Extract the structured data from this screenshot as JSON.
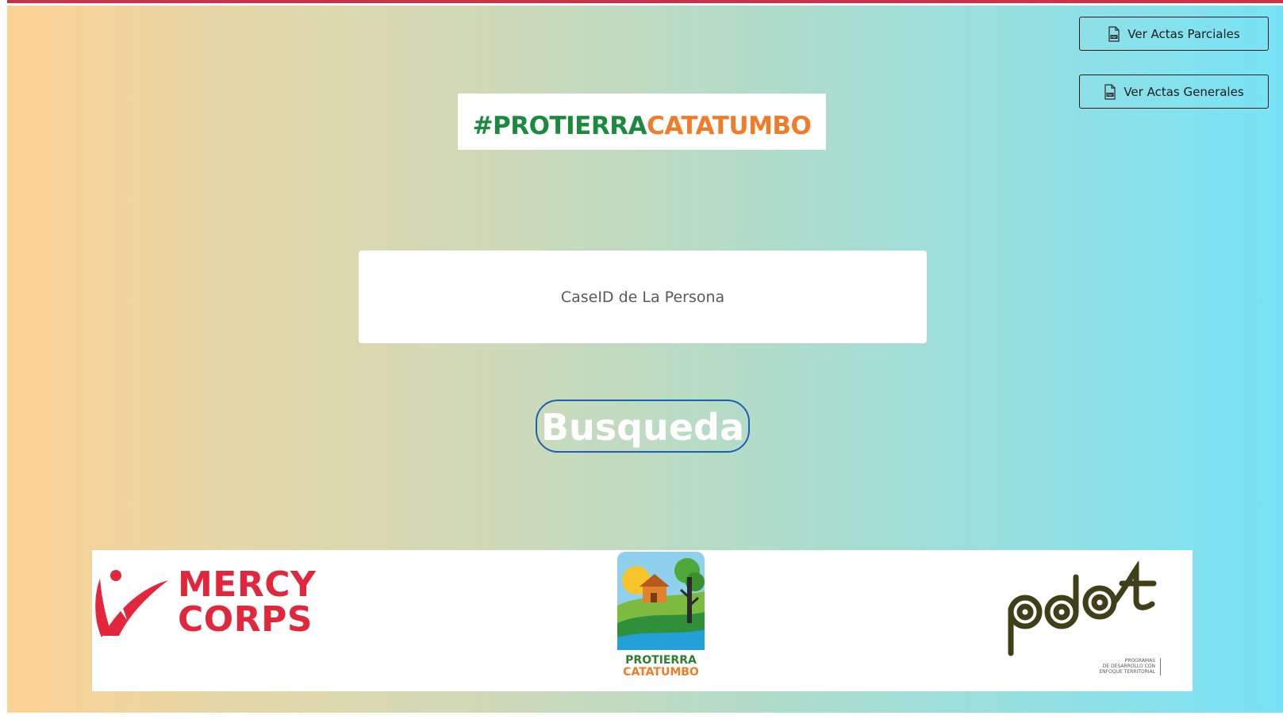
{
  "actions": {
    "ver_actas_parciales": "Ver Actas Parciales",
    "ver_actas_generales": "Ver Actas Generales",
    "icon": "pdf-file-icon"
  },
  "banner": {
    "hashtag_prefix": "#PROTIERRA",
    "hashtag_suffix": "CATATUMBO"
  },
  "search": {
    "placeholder": "CaseID de La Persona",
    "value": "",
    "button_label": "Busqueda"
  },
  "sponsors": {
    "mercy_corps": {
      "line1": "MERCY",
      "line2": "CORPS"
    },
    "protierra": {
      "line1": "PROTIERRA",
      "line2": "CATATUMBO"
    },
    "pdet": {
      "caption_line1": "PROGRAMAS",
      "caption_line2": "DE DESARROLLO CON",
      "caption_line3": "ENFOQUE TERRITORIAL"
    }
  },
  "colors": {
    "gradient_left": "#fdd294",
    "gradient_right": "#78e3f6",
    "hashtag_green": "#1c8a3e",
    "hashtag_orange": "#f07c2a",
    "busqueda_border": "#1d5fb0",
    "mercy_red": "#e2263c"
  }
}
